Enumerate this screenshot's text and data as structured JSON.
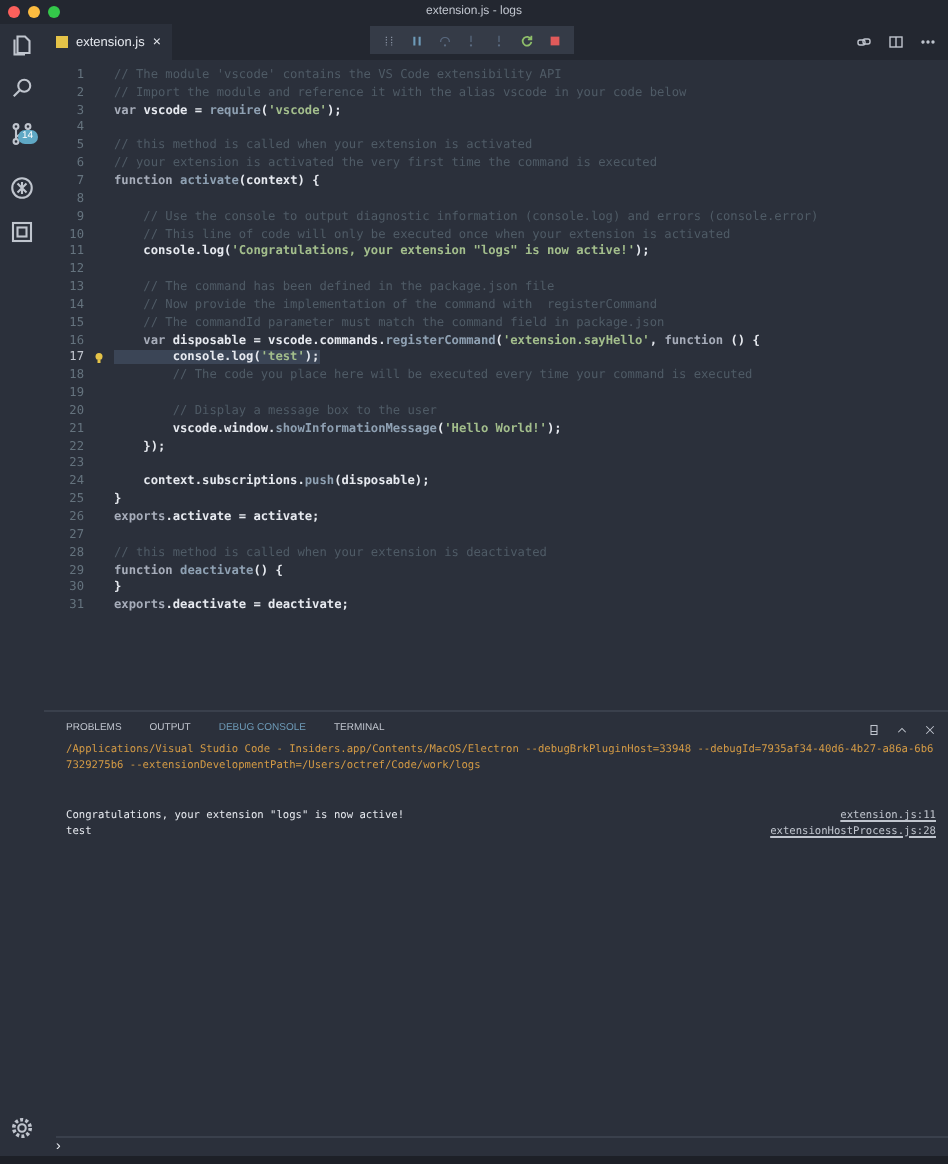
{
  "window": {
    "title": "extension.js - logs"
  },
  "activity_bar": {
    "scm_badge": "14"
  },
  "tabs": [
    {
      "label": "extension.js",
      "selected": true,
      "close": "×"
    }
  ],
  "editor": {
    "lines": [
      {
        "number": "1",
        "current": false,
        "segments": [
          {
            "text": "// The module 'vscode' contains the VS Code extensibility API",
            "kind": "comment"
          }
        ]
      },
      {
        "number": "2",
        "current": false,
        "segments": [
          {
            "text": "// Import the module and reference it with the alias vscode in your code below",
            "kind": "comment"
          }
        ]
      },
      {
        "number": "3",
        "current": false,
        "segments": [
          {
            "text": "var ",
            "kind": "keyword"
          },
          {
            "text": "vscode = ",
            "kind": "plain"
          },
          {
            "text": "require",
            "kind": "func"
          },
          {
            "text": "(",
            "kind": "plain"
          },
          {
            "text": "'vscode'",
            "kind": "string"
          },
          {
            "text": ");",
            "kind": "plain"
          }
        ]
      },
      {
        "number": "4",
        "current": false
      },
      {
        "number": "5",
        "current": false,
        "segments": [
          {
            "text": "// this method is called when your extension is activated",
            "kind": "comment"
          }
        ]
      },
      {
        "number": "6",
        "current": false,
        "segments": [
          {
            "text": "// your extension is activated the very first time the command is executed",
            "kind": "comment"
          }
        ]
      },
      {
        "number": "7",
        "current": false,
        "segments": [
          {
            "text": "function ",
            "kind": "keyword"
          },
          {
            "text": "activate",
            "kind": "func"
          },
          {
            "text": "(context) {",
            "kind": "plain"
          }
        ]
      },
      {
        "number": "8",
        "current": false
      },
      {
        "number": "9",
        "current": false,
        "segments": [
          {
            "text": "    // Use the console to output diagnostic information (console.log) and errors (console.error)",
            "kind": "comment"
          }
        ]
      },
      {
        "number": "10",
        "current": false,
        "segments": [
          {
            "text": "    // This line of code will only be executed once when your extension is activated",
            "kind": "comment"
          }
        ]
      },
      {
        "number": "11",
        "current": false,
        "segments": [
          {
            "text": "    console.log(",
            "kind": "plain"
          },
          {
            "text": "'Congratulations, your extension \"logs\" is now active!'",
            "kind": "string"
          },
          {
            "text": ");",
            "kind": "plain"
          }
        ]
      },
      {
        "number": "12",
        "current": false
      },
      {
        "number": "13",
        "current": false,
        "segments": [
          {
            "text": "    // The command has been defined in the package.json file",
            "kind": "comment"
          }
        ]
      },
      {
        "number": "14",
        "current": false,
        "segments": [
          {
            "text": "    // Now provide the implementation of the command with  registerCommand",
            "kind": "comment"
          }
        ]
      },
      {
        "number": "15",
        "current": false,
        "segments": [
          {
            "text": "    // The commandId parameter must match the command field in package.json",
            "kind": "comment"
          }
        ]
      },
      {
        "number": "16",
        "current": false,
        "segments": [
          {
            "text": "    var ",
            "kind": "keyword"
          },
          {
            "text": "disposable = vscode.commands.",
            "kind": "plain"
          },
          {
            "text": "registerCommand",
            "kind": "func"
          },
          {
            "text": "(",
            "kind": "plain"
          },
          {
            "text": "'extension.sayHello'",
            "kind": "string"
          },
          {
            "text": ", ",
            "kind": "plain"
          },
          {
            "text": "function ",
            "kind": "keyword"
          },
          {
            "text": "() {",
            "kind": "plain"
          }
        ]
      },
      {
        "number": "17",
        "current": true,
        "segments": [
          {
            "text": "        console.log(",
            "kind": "plain"
          },
          {
            "text": "'test'",
            "kind": "string"
          },
          {
            "text": ");",
            "kind": "plain"
          }
        ]
      },
      {
        "number": "18",
        "current": false,
        "segments": [
          {
            "text": "        // The code you place here will be executed every time your command is executed",
            "kind": "comment"
          }
        ]
      },
      {
        "number": "19",
        "current": false
      },
      {
        "number": "20",
        "current": false,
        "segments": [
          {
            "text": "        // Display a message box to the user",
            "kind": "comment"
          }
        ]
      },
      {
        "number": "21",
        "current": false,
        "segments": [
          {
            "text": "        vscode.window.",
            "kind": "plain"
          },
          {
            "text": "showInformationMessage",
            "kind": "func"
          },
          {
            "text": "(",
            "kind": "plain"
          },
          {
            "text": "'Hello World!'",
            "kind": "string"
          },
          {
            "text": ");",
            "kind": "plain"
          }
        ]
      },
      {
        "number": "22",
        "current": false,
        "segments": [
          {
            "text": "    });",
            "kind": "plain"
          }
        ]
      },
      {
        "number": "23",
        "current": false
      },
      {
        "number": "24",
        "current": false,
        "segments": [
          {
            "text": "    context.subscriptions.",
            "kind": "plain"
          },
          {
            "text": "push",
            "kind": "func"
          },
          {
            "text": "(disposable);",
            "kind": "plain"
          }
        ]
      },
      {
        "number": "25",
        "current": false,
        "segments": [
          {
            "text": "}",
            "kind": "plain"
          }
        ]
      },
      {
        "number": "26",
        "current": false,
        "segments": [
          {
            "text": "exports",
            "kind": "keyword"
          },
          {
            "text": ".activate = activate;",
            "kind": "plain"
          }
        ]
      },
      {
        "number": "27",
        "current": false
      },
      {
        "number": "28",
        "current": false,
        "segments": [
          {
            "text": "// this method is called when your extension is deactivated",
            "kind": "comment"
          }
        ]
      },
      {
        "number": "29",
        "current": false,
        "segments": [
          {
            "text": "function ",
            "kind": "keyword"
          },
          {
            "text": "deactivate",
            "kind": "func"
          },
          {
            "text": "() {",
            "kind": "plain"
          }
        ]
      },
      {
        "number": "30",
        "current": false,
        "segments": [
          {
            "text": "}",
            "kind": "plain"
          }
        ]
      },
      {
        "number": "31",
        "current": false,
        "segments": [
          {
            "text": "exports",
            "kind": "keyword"
          },
          {
            "text": ".deactivate = deactivate;",
            "kind": "plain"
          }
        ]
      }
    ]
  },
  "panel": {
    "tabs": [
      {
        "label": "PROBLEMS",
        "selected": false
      },
      {
        "label": "OUTPUT",
        "selected": false
      },
      {
        "label": "DEBUG CONSOLE",
        "selected": true
      },
      {
        "label": "TERMINAL",
        "selected": false
      }
    ],
    "entries": [
      {
        "kind": "command",
        "text": "/Applications/Visual Studio Code - Insiders.app/Contents/MacOS/Electron --debugBrkPluginHost=33948 --debugId=7935af34-40d6-4b27-a86a-6b67329275b6 --extensionDevelopmentPath=/Users/octref/Code/work/logs"
      },
      {
        "kind": "log",
        "text": "Congratulations, your extension \"logs\" is now active!",
        "source": "extension.js:11"
      },
      {
        "kind": "log",
        "text": "test",
        "source": "extensionHostProcess.js:28"
      }
    ],
    "prompt": "›"
  }
}
